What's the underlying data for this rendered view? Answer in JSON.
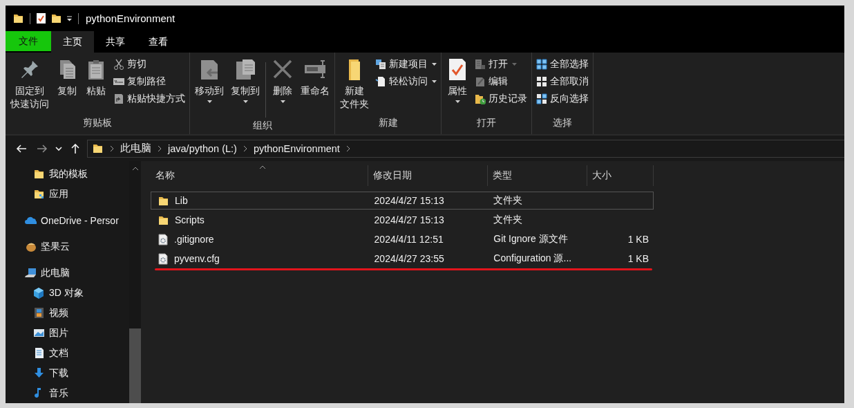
{
  "window": {
    "title": "pythonEnvironment"
  },
  "ribbon_tabs": [
    {
      "label": "文件",
      "kind": "file",
      "selected": false
    },
    {
      "label": "主页",
      "kind": "tab",
      "selected": true
    },
    {
      "label": "共享",
      "kind": "tab",
      "selected": false
    },
    {
      "label": "查看",
      "kind": "tab",
      "selected": false
    }
  ],
  "ribbon": {
    "groups": [
      {
        "label": "剪贴板",
        "items": [
          {
            "lines": [
              "固定到",
              "快速访问"
            ],
            "kind": "large",
            "dropdown": false
          },
          {
            "label": "复制",
            "kind": "large",
            "dropdown": false
          },
          {
            "label": "粘贴",
            "kind": "large",
            "dropdown": false
          },
          {
            "label": "剪切",
            "kind": "small",
            "dropdown": false
          },
          {
            "label": "复制路径",
            "kind": "small",
            "dropdown": false
          },
          {
            "label": "粘贴快捷方式",
            "kind": "small",
            "dropdown": false
          }
        ]
      },
      {
        "label": "组织",
        "items": [
          {
            "label": "移动到",
            "kind": "large",
            "dropdown": true
          },
          {
            "label": "复制到",
            "kind": "large",
            "dropdown": true
          },
          {
            "label": "删除",
            "kind": "large",
            "dropdown": true
          },
          {
            "label": "重命名",
            "kind": "large",
            "dropdown": false
          }
        ]
      },
      {
        "label": "新建",
        "items": [
          {
            "lines": [
              "新建",
              "文件夹"
            ],
            "kind": "large",
            "dropdown": false
          },
          {
            "label": "新建项目",
            "kind": "small",
            "dropdown": true
          },
          {
            "label": "轻松访问",
            "kind": "small",
            "dropdown": true
          }
        ]
      },
      {
        "label": "打开",
        "items": [
          {
            "label": "属性",
            "kind": "large",
            "dropdown": true
          },
          {
            "label": "打开",
            "kind": "small",
            "dropdown": true
          },
          {
            "label": "编辑",
            "kind": "small",
            "dropdown": false
          },
          {
            "label": "历史记录",
            "kind": "small",
            "dropdown": false
          }
        ]
      },
      {
        "label": "选择",
        "items": [
          {
            "label": "全部选择",
            "kind": "small",
            "dropdown": false
          },
          {
            "label": "全部取消",
            "kind": "small",
            "dropdown": false
          },
          {
            "label": "反向选择",
            "kind": "small",
            "dropdown": false
          }
        ]
      }
    ]
  },
  "nav_buttons": [
    {
      "kind": "back",
      "disabled": false
    },
    {
      "kind": "forward",
      "disabled": true
    },
    {
      "kind": "recent",
      "disabled": false
    },
    {
      "kind": "up",
      "disabled": false
    }
  ],
  "address": {
    "segments": [
      "此电脑",
      "java/python (L:)",
      "pythonEnvironment"
    ]
  },
  "sidebar": {
    "quick_access": {
      "children": [
        {
          "label": "我的模板",
          "kind": "folder"
        },
        {
          "label": "应用",
          "kind": "app"
        }
      ]
    },
    "items": [
      {
        "label": "OneDrive - Persor",
        "kind": "cloud"
      },
      {
        "label": "坚果云",
        "kind": "nut"
      },
      {
        "label": "此电脑",
        "kind": "computer",
        "children": [
          {
            "label": "3D 对象",
            "kind": "cube"
          },
          {
            "label": "视频",
            "kind": "video"
          },
          {
            "label": "图片",
            "kind": "picture"
          },
          {
            "label": "文档",
            "kind": "document"
          },
          {
            "label": "下载",
            "kind": "download"
          },
          {
            "label": "音乐",
            "kind": "music"
          }
        ]
      }
    ]
  },
  "file_list": {
    "columns": [
      {
        "label": "名称",
        "sorted": true
      },
      {
        "label": "修改日期",
        "sorted": false
      },
      {
        "label": "类型",
        "sorted": false
      },
      {
        "label": "大小",
        "sorted": false
      }
    ],
    "rows": [
      {
        "name": "Lib",
        "kind": "folder",
        "date": "2024/4/27 15:13",
        "type": "文件夹",
        "focused": true,
        "underlined": false
      },
      {
        "name": "Scripts",
        "kind": "folder",
        "date": "2024/4/27 15:13",
        "type": "文件夹",
        "focused": false,
        "underlined": false
      },
      {
        "name": ".gitignore",
        "kind": "file",
        "date": "2024/4/11 12:51",
        "type": "Git Ignore 源文件",
        "size": "1 KB",
        "focused": false,
        "underlined": false
      },
      {
        "name": "pyvenv.cfg",
        "kind": "file",
        "date": "2024/4/27 23:55",
        "type": "Configuration 源...",
        "size": "1 KB",
        "focused": false,
        "underlined": true
      }
    ]
  }
}
